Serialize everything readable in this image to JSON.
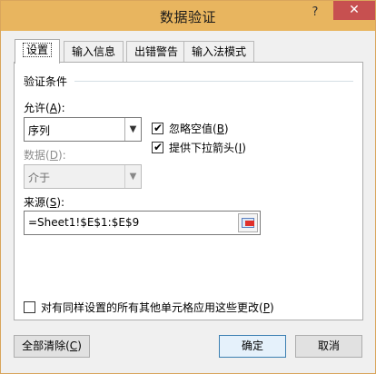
{
  "window": {
    "title": "数据验证",
    "help": "?",
    "close": "✕"
  },
  "tabs": [
    {
      "label": "设置"
    },
    {
      "label": "输入信息"
    },
    {
      "label": "出错警告"
    },
    {
      "label": "输入法模式"
    }
  ],
  "settings": {
    "group_title": "验证条件",
    "allow": {
      "label_prefix": "允许(",
      "label_key": "A",
      "label_suffix": "):",
      "value": "序列"
    },
    "data": {
      "label_prefix": "数据(",
      "label_key": "D",
      "label_suffix": "):",
      "value": "介于"
    },
    "ignore_blank": {
      "label_prefix": "忽略空值(",
      "label_key": "B",
      "label_suffix": ")",
      "checked": true
    },
    "in_cell_dropdown": {
      "label_prefix": "提供下拉箭头(",
      "label_key": "I",
      "label_suffix": ")",
      "checked": true
    },
    "source": {
      "label_prefix": "来源(",
      "label_key": "S",
      "label_suffix": "):",
      "value": "=Sheet1!$E$1:$E$9"
    },
    "apply_all": {
      "label_prefix": "对有同样设置的所有其他单元格应用这些更改(",
      "label_key": "P",
      "label_suffix": ")",
      "checked": false
    }
  },
  "buttons": {
    "clear_all_prefix": "全部清除(",
    "clear_all_key": "C",
    "clear_all_suffix": ")",
    "ok": "确定",
    "cancel": "取消"
  },
  "glyphs": {
    "check": "✔",
    "dropdown": "▼"
  },
  "icons": {
    "source_picker": "range-select-icon"
  }
}
